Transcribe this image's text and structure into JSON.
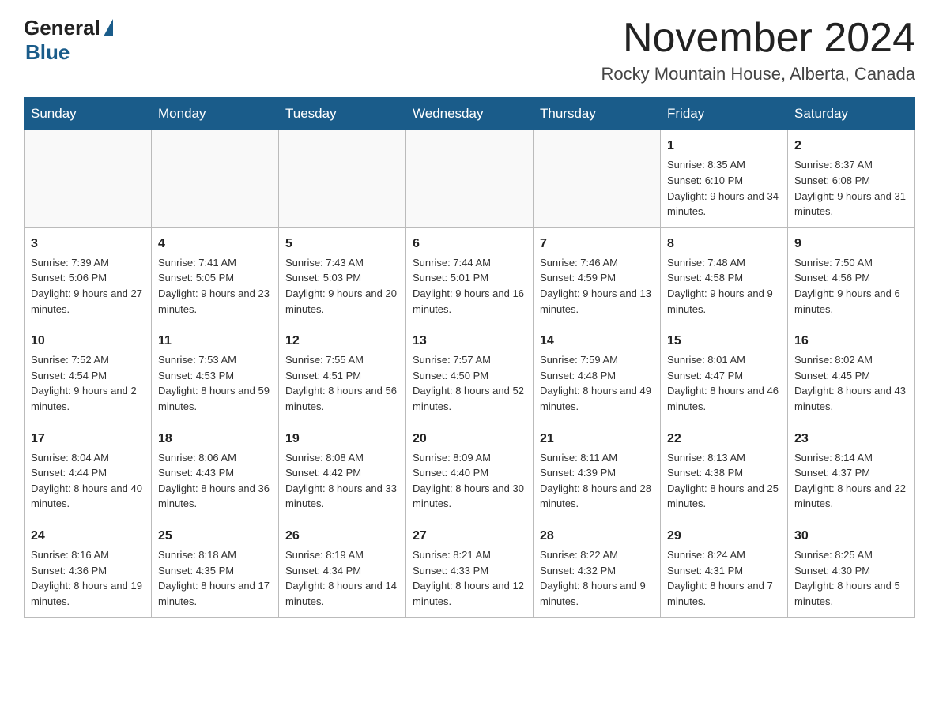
{
  "header": {
    "logo": {
      "general": "General",
      "blue": "Blue"
    },
    "month_title": "November 2024",
    "location": "Rocky Mountain House, Alberta, Canada"
  },
  "calendar": {
    "days_of_week": [
      "Sunday",
      "Monday",
      "Tuesday",
      "Wednesday",
      "Thursday",
      "Friday",
      "Saturday"
    ],
    "weeks": [
      [
        {
          "day": "",
          "info": ""
        },
        {
          "day": "",
          "info": ""
        },
        {
          "day": "",
          "info": ""
        },
        {
          "day": "",
          "info": ""
        },
        {
          "day": "",
          "info": ""
        },
        {
          "day": "1",
          "info": "Sunrise: 8:35 AM\nSunset: 6:10 PM\nDaylight: 9 hours and 34 minutes."
        },
        {
          "day": "2",
          "info": "Sunrise: 8:37 AM\nSunset: 6:08 PM\nDaylight: 9 hours and 31 minutes."
        }
      ],
      [
        {
          "day": "3",
          "info": "Sunrise: 7:39 AM\nSunset: 5:06 PM\nDaylight: 9 hours and 27 minutes."
        },
        {
          "day": "4",
          "info": "Sunrise: 7:41 AM\nSunset: 5:05 PM\nDaylight: 9 hours and 23 minutes."
        },
        {
          "day": "5",
          "info": "Sunrise: 7:43 AM\nSunset: 5:03 PM\nDaylight: 9 hours and 20 minutes."
        },
        {
          "day": "6",
          "info": "Sunrise: 7:44 AM\nSunset: 5:01 PM\nDaylight: 9 hours and 16 minutes."
        },
        {
          "day": "7",
          "info": "Sunrise: 7:46 AM\nSunset: 4:59 PM\nDaylight: 9 hours and 13 minutes."
        },
        {
          "day": "8",
          "info": "Sunrise: 7:48 AM\nSunset: 4:58 PM\nDaylight: 9 hours and 9 minutes."
        },
        {
          "day": "9",
          "info": "Sunrise: 7:50 AM\nSunset: 4:56 PM\nDaylight: 9 hours and 6 minutes."
        }
      ],
      [
        {
          "day": "10",
          "info": "Sunrise: 7:52 AM\nSunset: 4:54 PM\nDaylight: 9 hours and 2 minutes."
        },
        {
          "day": "11",
          "info": "Sunrise: 7:53 AM\nSunset: 4:53 PM\nDaylight: 8 hours and 59 minutes."
        },
        {
          "day": "12",
          "info": "Sunrise: 7:55 AM\nSunset: 4:51 PM\nDaylight: 8 hours and 56 minutes."
        },
        {
          "day": "13",
          "info": "Sunrise: 7:57 AM\nSunset: 4:50 PM\nDaylight: 8 hours and 52 minutes."
        },
        {
          "day": "14",
          "info": "Sunrise: 7:59 AM\nSunset: 4:48 PM\nDaylight: 8 hours and 49 minutes."
        },
        {
          "day": "15",
          "info": "Sunrise: 8:01 AM\nSunset: 4:47 PM\nDaylight: 8 hours and 46 minutes."
        },
        {
          "day": "16",
          "info": "Sunrise: 8:02 AM\nSunset: 4:45 PM\nDaylight: 8 hours and 43 minutes."
        }
      ],
      [
        {
          "day": "17",
          "info": "Sunrise: 8:04 AM\nSunset: 4:44 PM\nDaylight: 8 hours and 40 minutes."
        },
        {
          "day": "18",
          "info": "Sunrise: 8:06 AM\nSunset: 4:43 PM\nDaylight: 8 hours and 36 minutes."
        },
        {
          "day": "19",
          "info": "Sunrise: 8:08 AM\nSunset: 4:42 PM\nDaylight: 8 hours and 33 minutes."
        },
        {
          "day": "20",
          "info": "Sunrise: 8:09 AM\nSunset: 4:40 PM\nDaylight: 8 hours and 30 minutes."
        },
        {
          "day": "21",
          "info": "Sunrise: 8:11 AM\nSunset: 4:39 PM\nDaylight: 8 hours and 28 minutes."
        },
        {
          "day": "22",
          "info": "Sunrise: 8:13 AM\nSunset: 4:38 PM\nDaylight: 8 hours and 25 minutes."
        },
        {
          "day": "23",
          "info": "Sunrise: 8:14 AM\nSunset: 4:37 PM\nDaylight: 8 hours and 22 minutes."
        }
      ],
      [
        {
          "day": "24",
          "info": "Sunrise: 8:16 AM\nSunset: 4:36 PM\nDaylight: 8 hours and 19 minutes."
        },
        {
          "day": "25",
          "info": "Sunrise: 8:18 AM\nSunset: 4:35 PM\nDaylight: 8 hours and 17 minutes."
        },
        {
          "day": "26",
          "info": "Sunrise: 8:19 AM\nSunset: 4:34 PM\nDaylight: 8 hours and 14 minutes."
        },
        {
          "day": "27",
          "info": "Sunrise: 8:21 AM\nSunset: 4:33 PM\nDaylight: 8 hours and 12 minutes."
        },
        {
          "day": "28",
          "info": "Sunrise: 8:22 AM\nSunset: 4:32 PM\nDaylight: 8 hours and 9 minutes."
        },
        {
          "day": "29",
          "info": "Sunrise: 8:24 AM\nSunset: 4:31 PM\nDaylight: 8 hours and 7 minutes."
        },
        {
          "day": "30",
          "info": "Sunrise: 8:25 AM\nSunset: 4:30 PM\nDaylight: 8 hours and 5 minutes."
        }
      ]
    ]
  }
}
